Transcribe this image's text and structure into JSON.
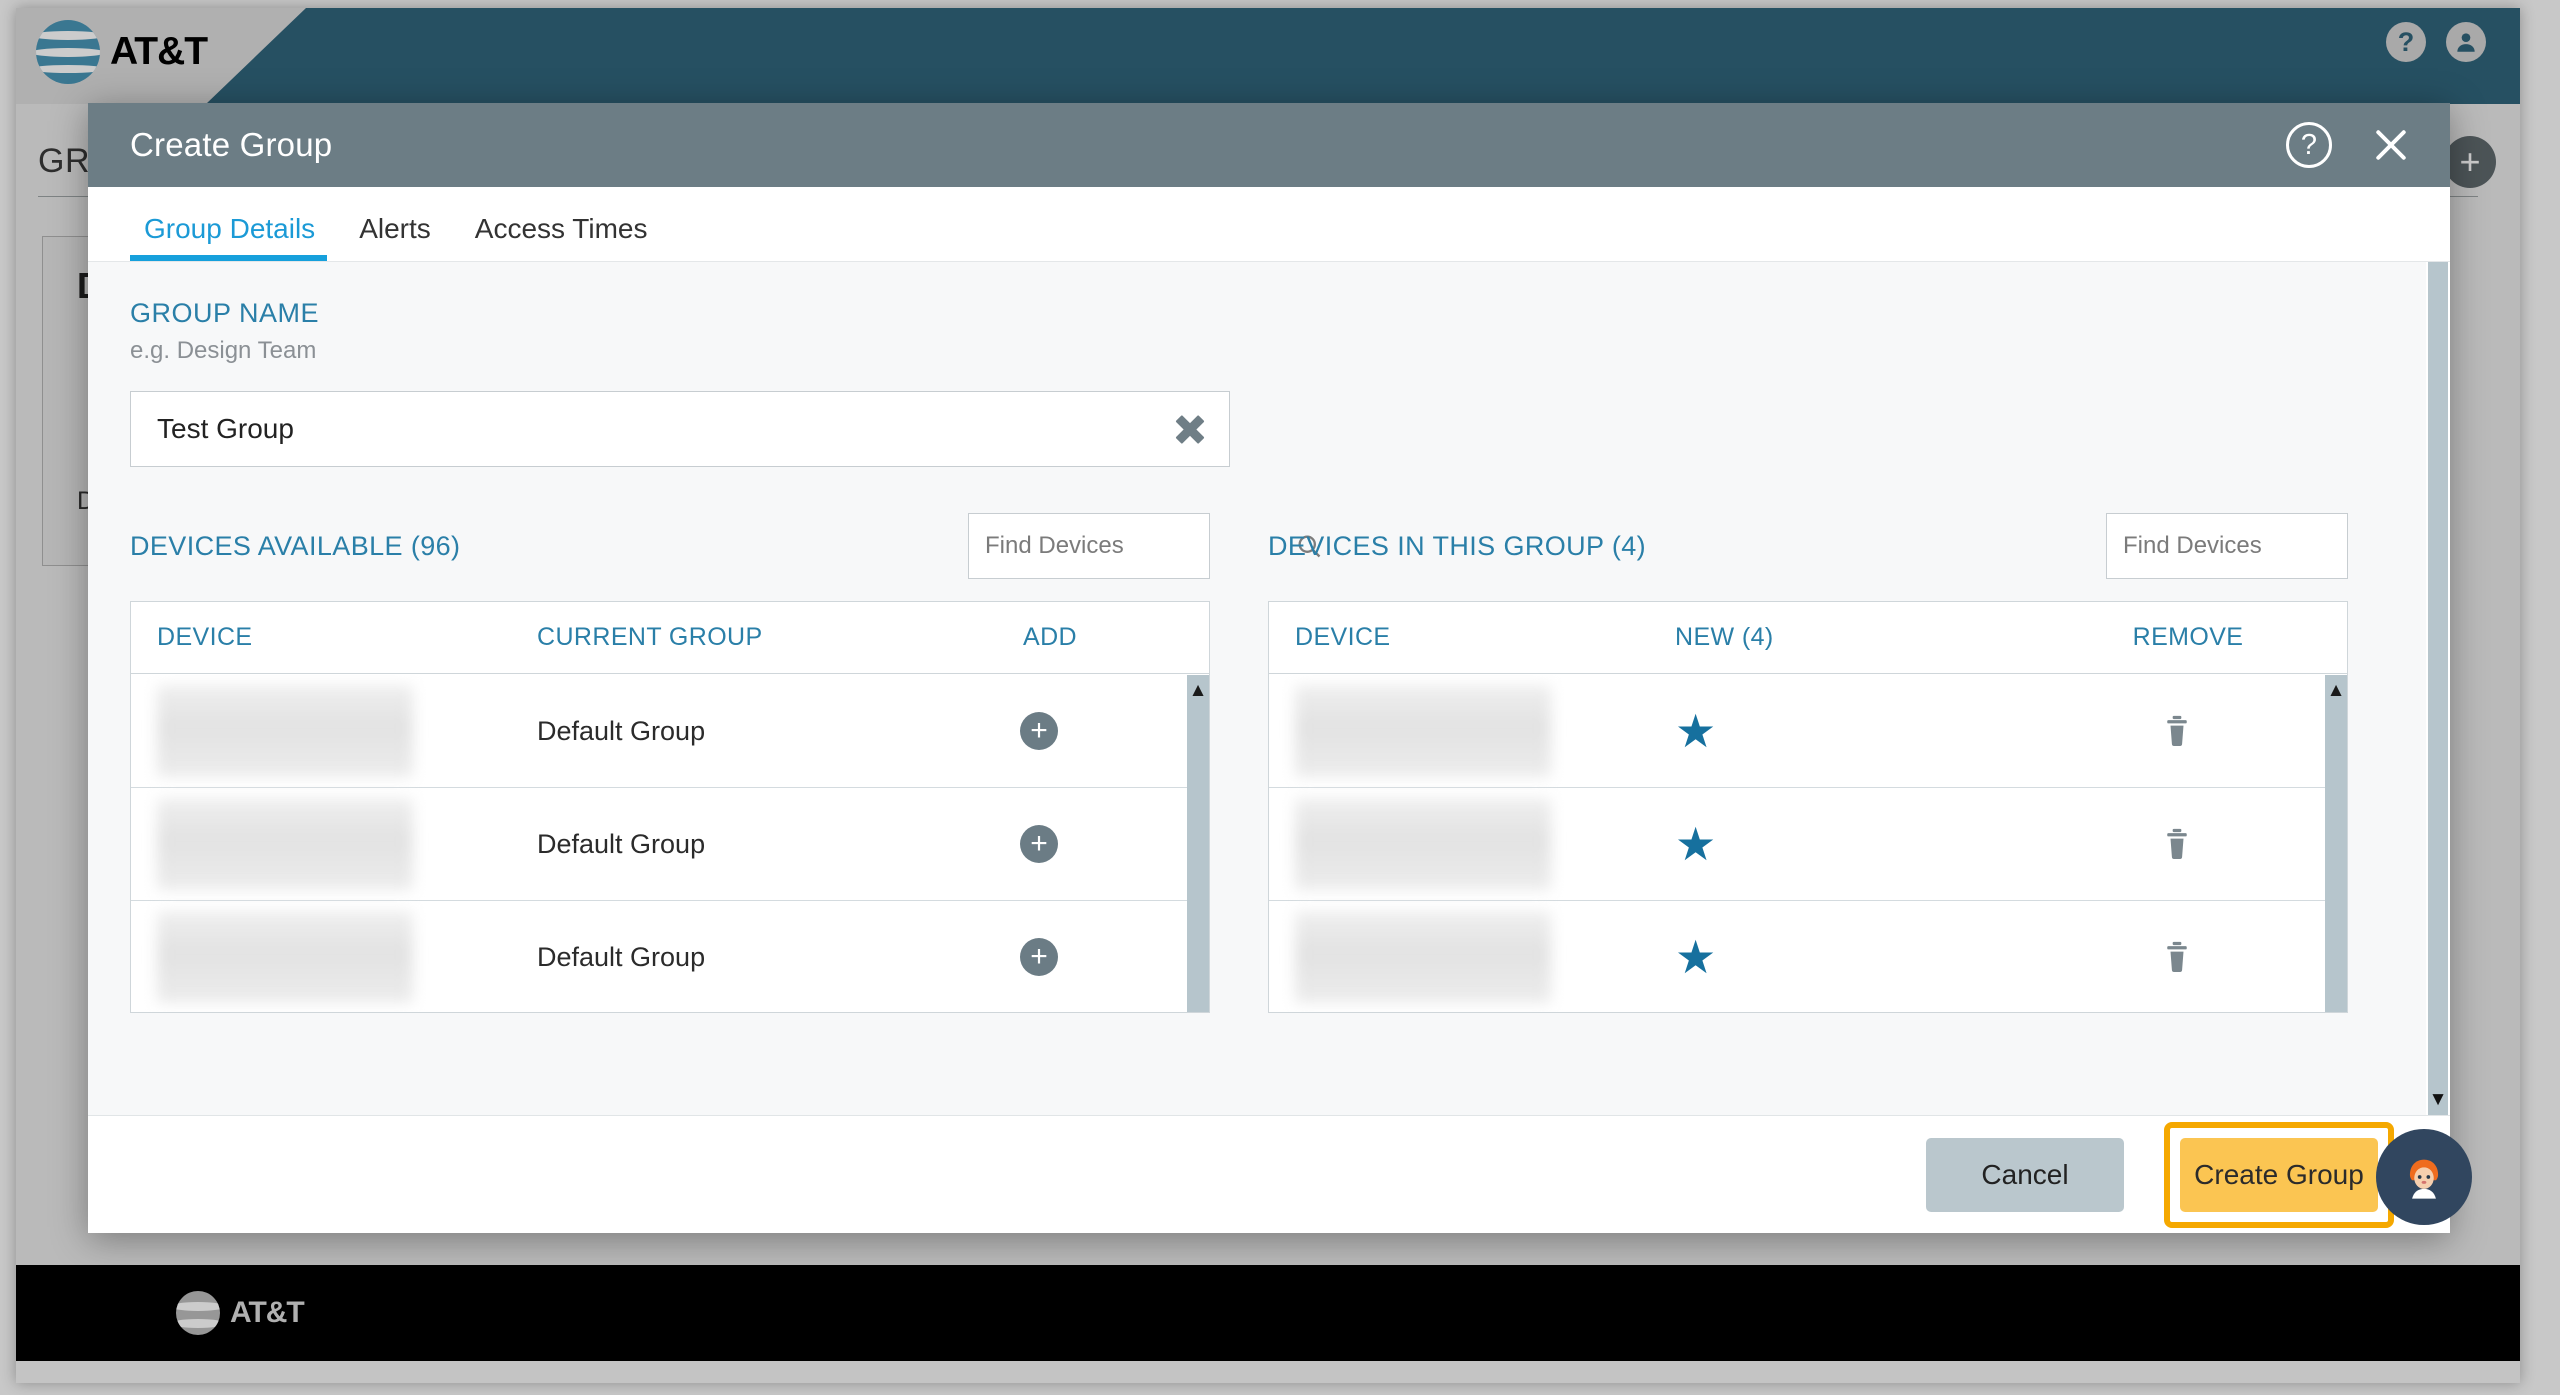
{
  "app": {
    "brand": "AT&T",
    "topbar": {
      "help_icon": "help-circle-icon",
      "account_icon": "account-circle-icon"
    },
    "page": {
      "title": "GROUPS",
      "add_label": "+",
      "card_title": "D",
      "card_sub": "De"
    },
    "footer_brand": "AT&T"
  },
  "modal": {
    "title": "Create Group",
    "help_glyph": "?",
    "close_glyph": "×",
    "tabs": [
      {
        "label": "Group Details",
        "active": true
      },
      {
        "label": "Alerts",
        "active": false
      },
      {
        "label": "Access Times",
        "active": false
      }
    ],
    "group_name": {
      "label": "GROUP NAME",
      "hint": "e.g. Design Team",
      "value": "Test Group",
      "placeholder": "e.g. Design Team",
      "clear_icon": "clear-x-icon"
    },
    "available": {
      "title": "DEVICES AVAILABLE (96)",
      "count": 96,
      "search_placeholder": "Find Devices",
      "search_value": "",
      "columns": [
        "DEVICE",
        "CURRENT GROUP",
        "ADD"
      ],
      "rows": [
        {
          "device": "",
          "group": "Default Group",
          "action": "+"
        },
        {
          "device": "",
          "group": "Default Group",
          "action": "+"
        },
        {
          "device": "",
          "group": "Default Group",
          "action": "+"
        }
      ]
    },
    "in_group": {
      "title": "DEVICES IN THIS GROUP (4)",
      "count": 4,
      "search_placeholder": "Find Devices",
      "search_value": "",
      "columns": [
        "DEVICE",
        "NEW (4)",
        "REMOVE"
      ],
      "rows": [
        {
          "device": "",
          "status": "★",
          "action": "delete"
        },
        {
          "device": "",
          "status": "★",
          "action": "delete"
        },
        {
          "device": "",
          "status": "★",
          "action": "delete"
        }
      ]
    },
    "footer": {
      "cancel_label": "Cancel",
      "submit_label": "Create Group"
    }
  },
  "chat": {
    "avatar_icon": "chat-agent-avatar"
  },
  "colors": {
    "brand_blue": "#0d6b96",
    "accent_blue": "#16a0dc",
    "link_blue": "#2a7fa8",
    "header_gray": "#6c7d85",
    "primary_yellow": "#fbc552",
    "highlight_orange": "#f5a800",
    "star_blue": "#16709e"
  }
}
